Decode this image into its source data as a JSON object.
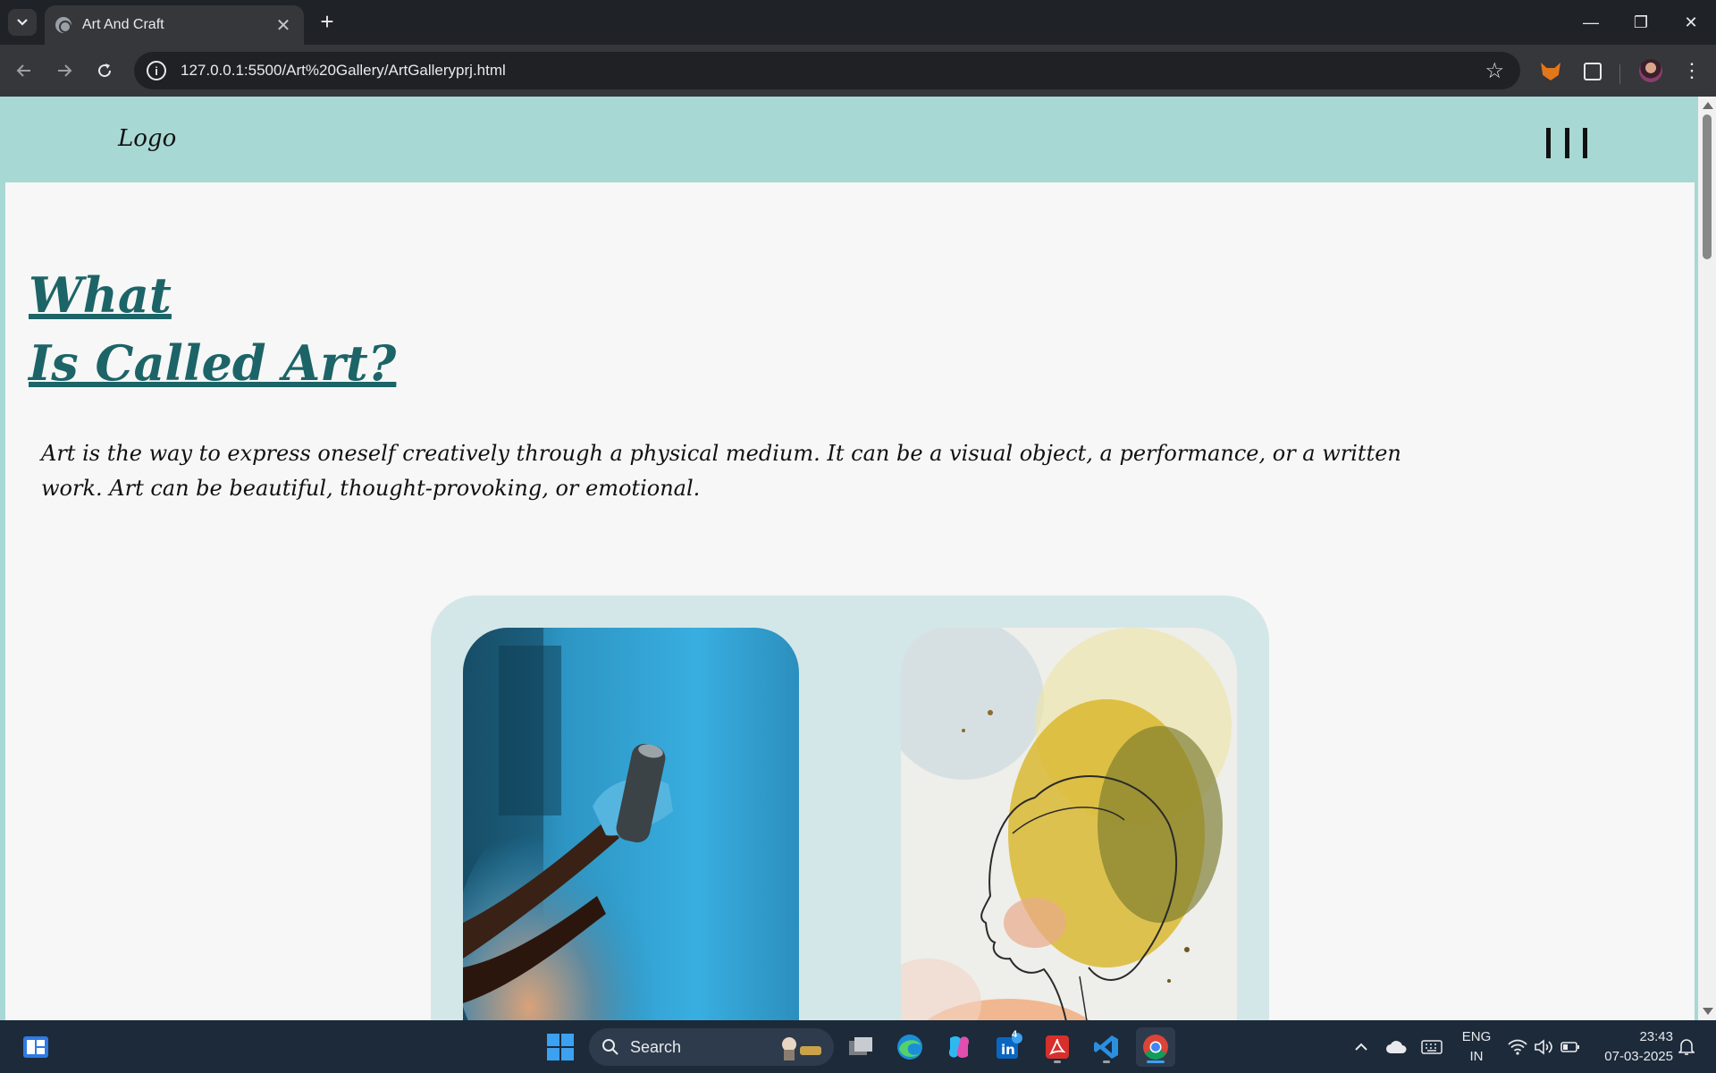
{
  "browser": {
    "tab_title": "Art And Craft",
    "url": "127.0.0.1:5500/Art%20Gallery/ArtGalleryprj.html"
  },
  "site": {
    "logo": "Logo",
    "hero_line1": "What",
    "hero_line2": "Is Called Art?",
    "intro": "Art is the way to express oneself creatively through a physical medium. It can be a visual object, a performance, or a written work. Art can be beautiful, thought-provoking, or emotional."
  },
  "taskbar": {
    "search_label": "Search",
    "linkedin_badge": "4",
    "lang_line1": "ENG",
    "lang_line2": "IN",
    "time": "23:43",
    "date": "07-03-2025"
  },
  "colors": {
    "header_bg": "#a8d8d4",
    "hero_title": "#1c6467",
    "gallery_bg": "#d4e7e8",
    "page_bg": "#f6f7f6"
  }
}
